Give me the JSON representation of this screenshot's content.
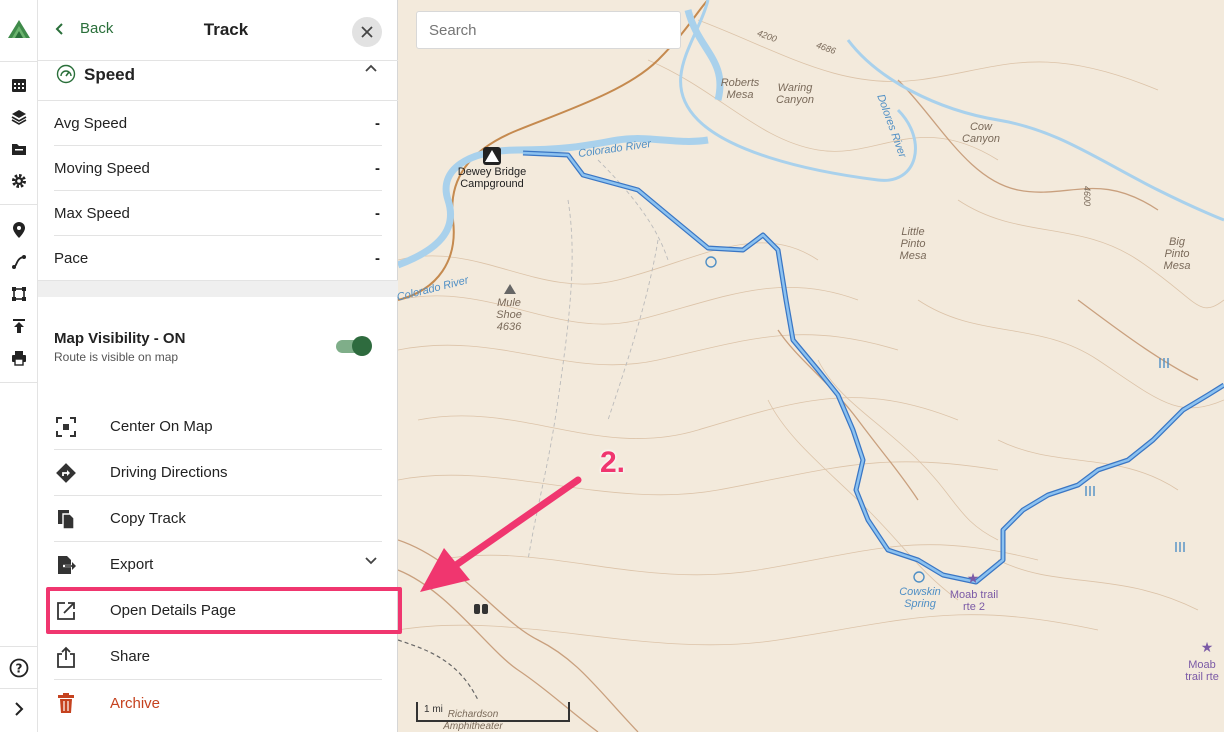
{
  "colors": {
    "accent_green": "#2a6f3a",
    "highlight_pink": "#f0366f",
    "archive_red": "#c5421f",
    "route_blue": "#4a90d9"
  },
  "rail": {
    "icons": [
      "logo-icon",
      "calendar-icon",
      "layers-icon",
      "folder-icon",
      "gear-icon",
      "pin-icon",
      "route-icon",
      "polygon-icon",
      "upload-icon",
      "print-icon",
      "help-icon",
      "expand-icon"
    ]
  },
  "panel": {
    "back_label": "Back",
    "title": "Track",
    "section": {
      "label": "Speed"
    },
    "stats": [
      {
        "label": "Avg Speed",
        "value": "-"
      },
      {
        "label": "Moving Speed",
        "value": "-"
      },
      {
        "label": "Max Speed",
        "value": "-"
      },
      {
        "label": "Pace",
        "value": "-"
      }
    ],
    "visibility": {
      "title": "Map Visibility - ON",
      "subtitle": "Route is visible on map",
      "enabled": true
    },
    "actions": [
      {
        "label": "Center On Map",
        "icon": "center-icon"
      },
      {
        "label": "Driving Directions",
        "icon": "directions-icon"
      },
      {
        "label": "Copy Track",
        "icon": "copy-icon"
      },
      {
        "label": "Export",
        "icon": "export-icon"
      },
      {
        "label": "Open Details Page",
        "icon": "external-link-icon"
      },
      {
        "label": "Share",
        "icon": "share-icon"
      },
      {
        "label": "Archive",
        "icon": "trash-icon"
      }
    ]
  },
  "map": {
    "search_placeholder": "Search",
    "annotation": "2.",
    "scale_label": "1 mi",
    "labels": {
      "campground": "Dewey Bridge Campground",
      "colorado_river": "Colorado River",
      "colorado_river_2": "Colorado River",
      "dolores_river": "Dolores River",
      "roberts_mesa": "Roberts Mesa",
      "waring_canyon": "Waring Canyon",
      "cow_canyon": "Cow Canyon",
      "little_pinto": "Little Pinto Mesa",
      "big_pinto": "Big Pinto Mesa",
      "mule_shoe": "Mule Shoe 4636",
      "cowskin": "Cowskin Spring",
      "moab_trail": "Moab trail rte 2",
      "moab_trail_2": "Moab trail rte",
      "elev_4200": "4200",
      "elev_4600": "4600",
      "elev_4686": "4686",
      "amphitheater": "Richardson Amphitheater"
    }
  }
}
